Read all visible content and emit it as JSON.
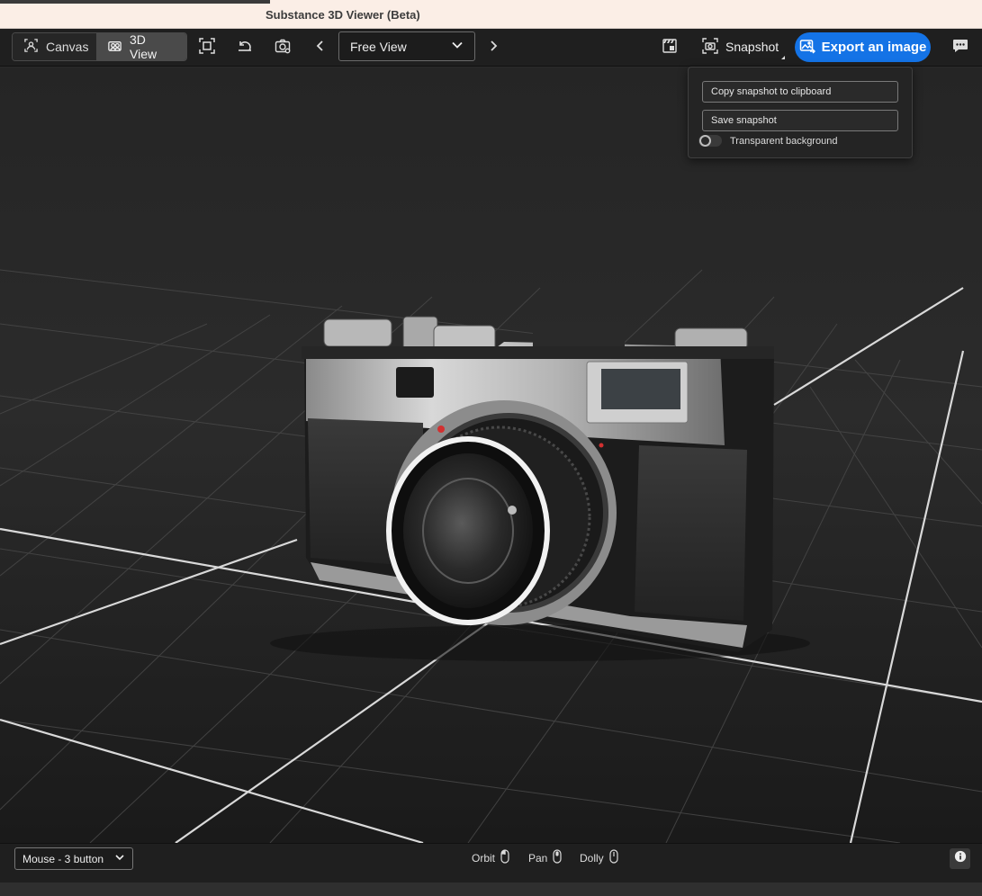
{
  "window": {
    "title": "Substance 3D Viewer (Beta)"
  },
  "toolbar": {
    "canvas_label": "Canvas",
    "view3d_label": "3D View",
    "view_select_value": "Free View",
    "snapshot_label": "Snapshot",
    "export_label": "Export an image",
    "icons": [
      "frame-icon",
      "undo-icon",
      "camera-settings-icon",
      "chevron-left-icon",
      "chevron-down-icon",
      "chevron-right-icon",
      "clapperboard-icon",
      "snapshot-icon",
      "image-export-icon",
      "chat-icon"
    ]
  },
  "snapshot_menu": {
    "copy_label": "Copy snapshot to clipboard",
    "save_label": "Save snapshot",
    "transparent_label": "Transparent background",
    "transparent_on": false
  },
  "statusbar": {
    "mouse_mode": "Mouse - 3 button",
    "orbit_label": "Orbit",
    "pan_label": "Pan",
    "dolly_label": "Dolly"
  },
  "colors": {
    "accent": "#1473e6",
    "toolbar_bg": "#1f1f1f",
    "viewport_bg": "#2b2b2b",
    "title_bg": "#fbeee6"
  }
}
